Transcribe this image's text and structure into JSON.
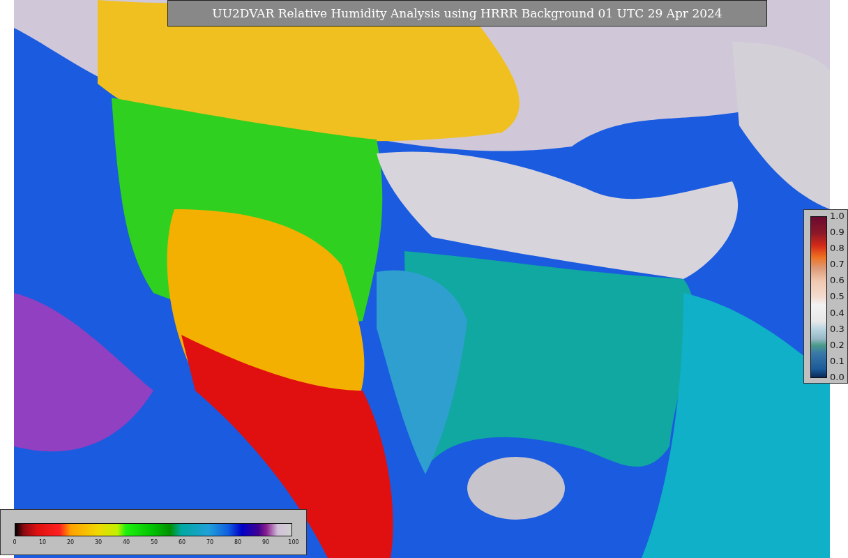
{
  "title": "UU2DVAR Relative Humidity Analysis using HRRR Background 01 UTC 29 Apr 2024",
  "side_legend": {
    "ticks": [
      "1.0",
      "0.9",
      "0.8",
      "0.7",
      "0.6",
      "0.5",
      "0.4",
      "0.3",
      "0.2",
      "0.1",
      "0.0"
    ]
  },
  "bottom_legend": {
    "ticks": [
      "0",
      "10",
      "20",
      "30",
      "40",
      "50",
      "60",
      "70",
      "80",
      "90",
      "100"
    ]
  }
}
